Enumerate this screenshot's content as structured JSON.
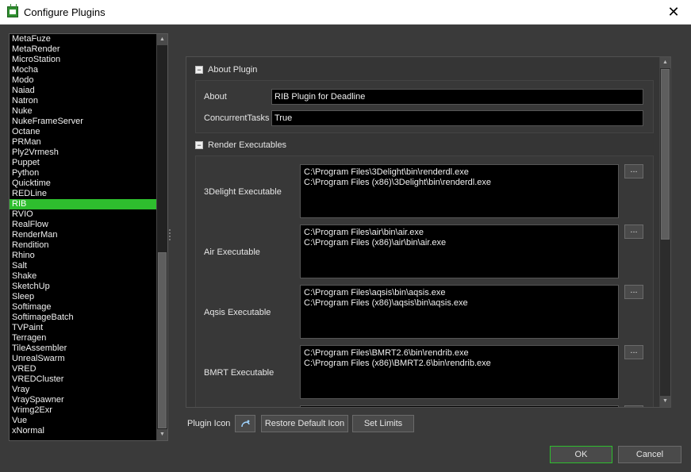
{
  "window": {
    "title": "Configure Plugins",
    "close_glyph": "✕"
  },
  "plugins": [
    "MetaFuze",
    "MetaRender",
    "MicroStation",
    "Mocha",
    "Modo",
    "Naiad",
    "Natron",
    "Nuke",
    "NukeFrameServer",
    "Octane",
    "PRMan",
    "Ply2Vrmesh",
    "Puppet",
    "Python",
    "Quicktime",
    "REDLine",
    "RIB",
    "RVIO",
    "RealFlow",
    "RenderMan",
    "Rendition",
    "Rhino",
    "Salt",
    "Shake",
    "SketchUp",
    "Sleep",
    "Softimage",
    "SoftimageBatch",
    "TVPaint",
    "Terragen",
    "TileAssembler",
    "UnrealSwarm",
    "VRED",
    "VREDCluster",
    "Vray",
    "VraySpawner",
    "Vrimg2Exr",
    "Vue",
    "xNormal"
  ],
  "selected_plugin": "RIB",
  "about_section": {
    "header": "About Plugin",
    "collapse_glyph": "−",
    "about_label": "About",
    "about_value": "RIB Plugin for Deadline",
    "concurrent_label": "ConcurrentTasks",
    "concurrent_value": "True"
  },
  "render_section": {
    "header": "Render Executables",
    "collapse_glyph": "−",
    "browse_label": "...",
    "executables": [
      {
        "label": "3Delight Executable",
        "lines": [
          "C:\\Program Files\\3Delight\\bin\\renderdl.exe",
          "C:\\Program Files (x86)\\3Delight\\bin\\renderdl.exe"
        ]
      },
      {
        "label": "Air Executable",
        "lines": [
          "C:\\Program Files\\air\\bin\\air.exe",
          "C:\\Program Files (x86)\\air\\bin\\air.exe"
        ]
      },
      {
        "label": "Aqsis Executable",
        "lines": [
          "C:\\Program Files\\aqsis\\bin\\aqsis.exe",
          "C:\\Program Files (x86)\\aqsis\\bin\\aqsis.exe"
        ]
      },
      {
        "label": "BMRT Executable",
        "lines": [
          "C:\\Program Files\\BMRT2.6\\bin\\rendrib.exe",
          "C:\\Program Files (x86)\\BMRT2.6\\bin\\rendrib.exe"
        ]
      }
    ]
  },
  "bottom": {
    "plugin_icon_label": "Plugin Icon",
    "restore_label": "Restore Default Icon",
    "limits_label": "Set Limits"
  },
  "dialog_buttons": {
    "ok": "OK",
    "cancel": "Cancel"
  },
  "colors": {
    "selection": "#2ebe2e",
    "background": "#3a3a3a",
    "field": "#000000"
  }
}
